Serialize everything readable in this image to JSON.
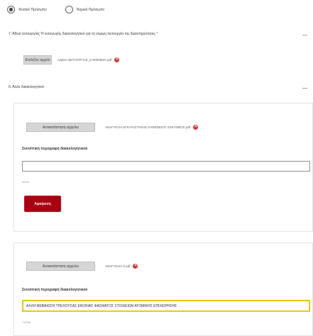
{
  "radio_group": {
    "options": [
      {
        "label": "Φυσικό Πρόσωπο",
        "selected": true
      },
      {
        "label": "Νομικό Πρόσωπο",
        "selected": false
      }
    ]
  },
  "section7": {
    "title": "7. Άδεια λειτουργίας Ή εισαγωγής δικαιολογητικό για τη νόμιμη λειτουργία της δραστηριότητας",
    "required_mark": "*",
    "file_button": "Επιλέξτε αρχείο",
    "file_name": "ΑΔΕΙΑ ΛΕΙΤΟΥΡΓΙΑΣ_ΚΑΦΕΝΕΙΟ.pdf"
  },
  "section8": {
    "title": "8. Άλλα δικαιολογητικά",
    "entries": [
      {
        "file_button": "Αντικατάσταση αρχείου",
        "file_name": "ΑΝΑΓΓΕΛΙΑ ΕΓΚΑΤΑΣΤΑΣΗΣ ΚΑΦΕΝΕΙΟΥ ΖΑΚΥΝΘΟΣ.pdf",
        "description_label": "Συνοπτική περιγραφή δικαιολογητικού",
        "description_value": "",
        "char_count": "0/100",
        "delete_button": "Αφαίρεση"
      },
      {
        "file_button": "Αντικατάσταση αρχείου",
        "file_name": "ΑΝΑΓΓΕΛΙΑ 2.pdf",
        "description_label": "Συνοπτική περιγραφή δικαιολογητικού",
        "description_value": "ΑΛΛΗ ΒΕΒΑΙΩΣΗ ΤΡΕΧΟΥΣΑΣ ΕΙΚΟΝΑΣ ΦΑΣΜΑΤΟΣ ΣΤΟΙΧΕΙΩΝ ΑΤΟΜΙΚΗΣ ΕΠΙΧΕΙΡΗΣΗΣ",
        "char_count": "71/100"
      }
    ]
  },
  "colors": {
    "danger": "#a80010",
    "focus": "#e6c600"
  }
}
